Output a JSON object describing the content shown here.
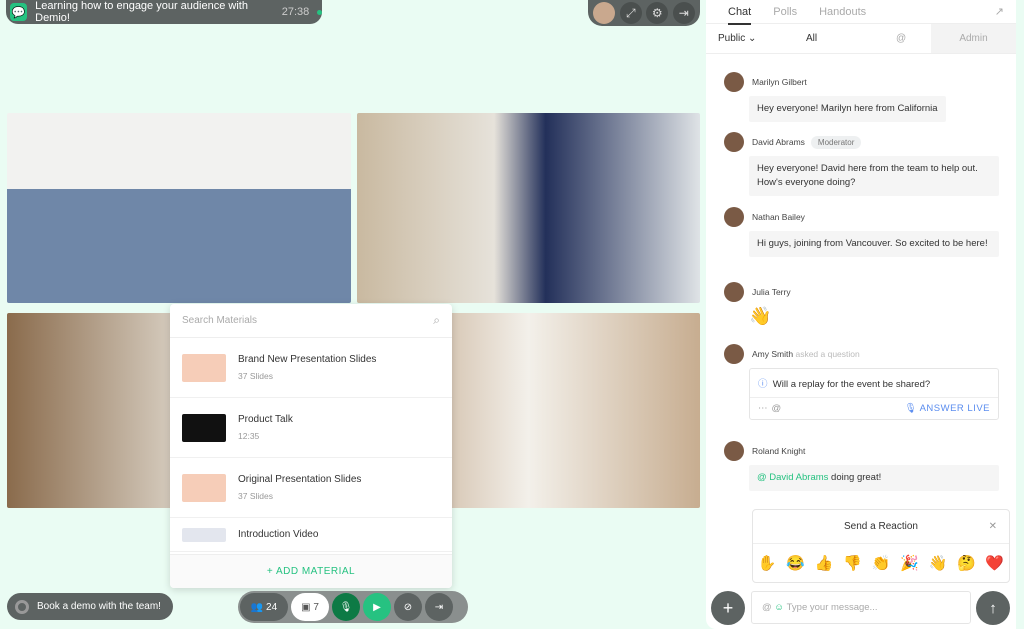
{
  "session": {
    "title": "Learning how to engage your audience with Demio!",
    "timer": "27:38"
  },
  "materials": {
    "search_placeholder": "Search Materials",
    "items": [
      {
        "title": "Brand New Presentation Slides",
        "sub": "37 Slides"
      },
      {
        "title": "Product Talk",
        "sub": "12:35"
      },
      {
        "title": "Original Presentation Slides",
        "sub": "37 Slides"
      },
      {
        "title": "Introduction Video",
        "sub": ""
      }
    ],
    "add_label": "+ ADD MATERIAL"
  },
  "bottom": {
    "book_label": "Book a demo with the team!",
    "attendees": "24",
    "materials_count": "7"
  },
  "chat": {
    "tabs": [
      "Chat",
      "Polls",
      "Handouts"
    ],
    "filter": {
      "scope": "Public",
      "all": "All",
      "admin": "Admin"
    },
    "messages": [
      {
        "name": "Marilyn Gilbert",
        "text": "Hey everyone! Marilyn here from California"
      },
      {
        "name": "David Abrams",
        "badge": "Moderator",
        "text": "Hey everyone! David here from the team to help out. How's everyone doing?"
      },
      {
        "name": "Nathan Bailey",
        "text": "Hi guys, joining from Vancouver. So excited to be here!"
      },
      {
        "name": "Julia Terry",
        "text": "👋"
      },
      {
        "name": "Amy Smith",
        "note": "asked a question",
        "text": "Will a replay for the event be shared?",
        "action": "ANSWER LIVE"
      },
      {
        "name": "Roland Knight",
        "mention": "@ David Abrams",
        "text": " doing great!"
      }
    ],
    "reaction": {
      "title": "Send a Reaction",
      "emojis": [
        "✋",
        "😂",
        "👍",
        "👎",
        "👏",
        "🎉",
        "👋",
        "🤔",
        "❤️"
      ]
    },
    "input_placeholder": "Type your message..."
  },
  "colors": {
    "accent": "#26c281",
    "bg": "#eafcf3",
    "dark": "#5d6362"
  }
}
